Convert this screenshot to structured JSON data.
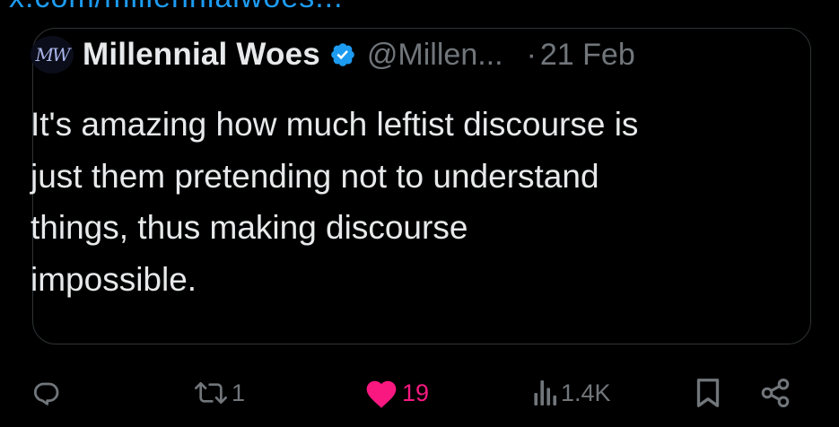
{
  "previous_tweet": {
    "link_text": "x.com/millennialwoes..."
  },
  "quote": {
    "avatar_text": "MW",
    "display_name": "Millennial Woes",
    "handle": "@Millen...",
    "separator": "·",
    "date": "21 Feb",
    "text": "It's amazing how much leftist discourse is\njust them pretending not to understand\nthings, thus making discourse\nimpossible."
  },
  "actions": {
    "reply": {
      "icon": "reply-icon"
    },
    "retweet": {
      "icon": "retweet-icon",
      "count": "1"
    },
    "like": {
      "icon": "heart-icon",
      "count": "19",
      "liked": true
    },
    "views": {
      "icon": "views-icon",
      "count": "1.4K"
    },
    "bookmark": {
      "icon": "bookmark-icon"
    },
    "share": {
      "icon": "share-icon"
    }
  },
  "colors": {
    "background": "#000000",
    "text": "#e7e9ea",
    "muted": "#71767b",
    "border": "#2f3336",
    "link": "#1d9bf0",
    "like": "#f91880",
    "verified": "#1d9bf0"
  }
}
